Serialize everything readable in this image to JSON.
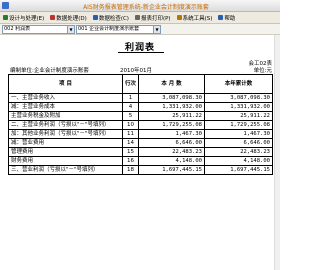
{
  "window": {
    "title": "AIS财务报表管理系统-新企业会计制度演示账套"
  },
  "menu": [
    {
      "label": "设计与处理(E)",
      "icon": "design-icon",
      "color": "#2b7a2b"
    },
    {
      "label": "数据处理(D)",
      "icon": "data-icon",
      "color": "#b33"
    },
    {
      "label": "数据检查(C)",
      "icon": "check-icon",
      "color": "#2a5db0"
    },
    {
      "label": "报表打印(P)",
      "icon": "print-icon",
      "color": "#666"
    },
    {
      "label": "系统工具(S)",
      "icon": "tools-icon",
      "color": "#b07a00"
    },
    {
      "label": "帮助",
      "icon": "help-icon",
      "color": "#2a5db0"
    }
  ],
  "selectors": {
    "report_select": "002 利润表",
    "company_select": "001 企业会计制度演示账套"
  },
  "report": {
    "title": "利润表",
    "form_no": "会工02表",
    "company": "编制单位:企业会计制度演示账套",
    "period": "2010年01月",
    "unit": "单位:元",
    "headers": [
      "项    目",
      "行次",
      "本 月 数",
      "本年累计数"
    ],
    "rows": [
      {
        "name": "一、主营业务收入",
        "line": "1",
        "month": "3,087,098.30",
        "ytd": "3,087,098.30",
        "indent": 0
      },
      {
        "name": "减：主营业务成本",
        "line": "4",
        "month": "1,331,932.00",
        "ytd": "1,331,932.00",
        "indent": 1
      },
      {
        "name": "主营业务税金及附加",
        "line": "5",
        "month": "25,911.22",
        "ytd": "25,911.22",
        "indent": 2
      },
      {
        "name": "二、主营业务利润（亏损以\"－\"号填列）",
        "line": "10",
        "month": "1,729,255.08",
        "ytd": "1,729,255.08",
        "indent": 0
      },
      {
        "name": "加：其他业务利润（亏损以\"－\"号填列）",
        "line": "11",
        "month": "1,467.30",
        "ytd": "1,467.30",
        "indent": 1
      },
      {
        "name": "减：营业费用",
        "line": "14",
        "month": "6,646.00",
        "ytd": "6,646.00",
        "indent": 1
      },
      {
        "name": "管理费用",
        "line": "15",
        "month": "22,483.23",
        "ytd": "22,483.23",
        "indent": 2
      },
      {
        "name": "财务费用",
        "line": "16",
        "month": "4,148.00",
        "ytd": "4,148.00",
        "indent": 2
      },
      {
        "name": "三、营业利润（亏损以\"－\"号填列）",
        "line": "18",
        "month": "1,697,445.15",
        "ytd": "1,697,445.15",
        "indent": 0
      }
    ]
  }
}
